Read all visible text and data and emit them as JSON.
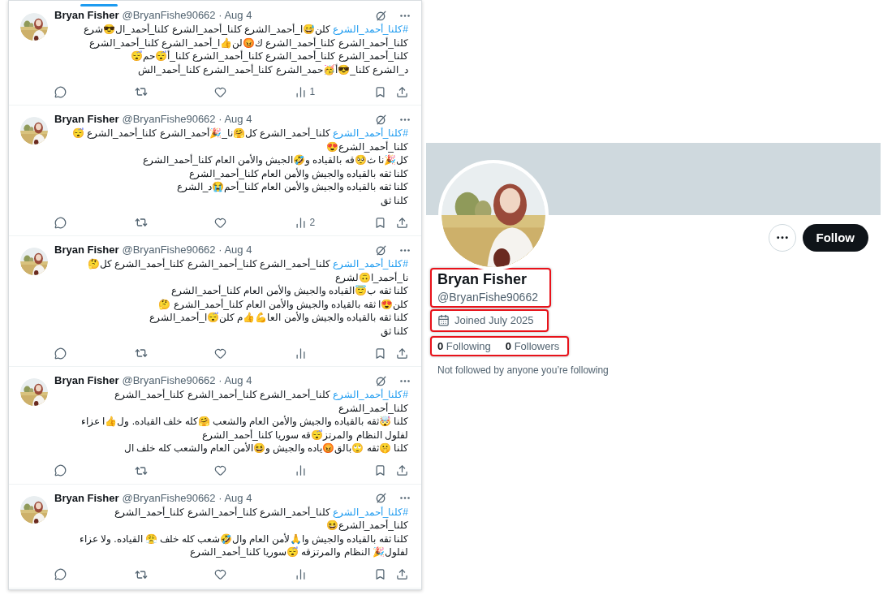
{
  "timeline": {
    "tweets": [
      {
        "author": "Bryan Fisher",
        "meta": "@BryanFishe90662 · Aug 4",
        "hashtag": "#كلنا_أحمد_الشرع",
        "first_line": " كلن😅ا_أحمد_الشرع كلنا_أحمد_الشرع كلنا_أحمد_ال😎شرع",
        "lines": [
          "كلنا_أحمد_الشرع كلنا_أحمد_الشرع ك😡لن👍ا_أحمد_الشرع كلنا_أحمد_الشرع",
          "كلنا_أحمد_الشرع كلنا_أحمد_الشرع كلنا_أحمد_الشرع كلنا_أ😴حم😴",
          "د_الشرع كلنا_😎أ🥳حمد_الشرع كلنا_أحمد_الشرع كلنا_أحمد_الش"
        ],
        "views": "1"
      },
      {
        "author": "Bryan Fisher",
        "meta": "@BryanFishe90662 · Aug 4",
        "hashtag": "#كلنا_أحمد_الشرع",
        "first_line": " كلنا_أحمد_الشرع كل🤗نا_🎉أحمد_الشرع كلنا_أحمد_الشرع 😴",
        "lines": [
          "كلنا_أحمد_الشرع😍",
          "كل🎉نا ث🥺قه بالقياده و🤣الجيش والأمن العام كلنا_أحمد_الشرع",
          "كلنا ثقه بالقياده والجيش والأمن العام كلنا_أحمد_الشرع",
          "كلنا ثقه بالقياده والجيش والأمن العام كلنا_أحم😭د_الشرع",
          "كلنا ثق"
        ],
        "views": "2"
      },
      {
        "author": "Bryan Fisher",
        "meta": "@BryanFishe90662 · Aug 4",
        "hashtag": "#كلنا_أحمد_الشرع",
        "first_line": " كلنا_أحمد_الشرع كلنا_أحمد_الشرع كلنا_أحمد_الشرع كل🤔",
        "lines": [
          "نا_أحمد_ا🙃لشرع",
          "كلنا ثقه ب😇القياده والجيش والأمن العام كلنا_أحمد_الشرع",
          "كلن😍ا ثقه بالقياده والجيش والأمن العام كلنا_أحمد_الشرع 🤔",
          "كلنا ثقه بالقياده والجيش والأمن العا💪👍م كلن😴ا_أحمد_الشرع",
          "كلنا ثق"
        ]
      },
      {
        "author": "Bryan Fisher",
        "meta": "@BryanFishe90662 · Aug 4",
        "hashtag": "#كلنا_أحمد_الشرع",
        "first_line": " كلنا_أحمد_الشرع كلنا_أحمد_الشرع كلنا_أحمد_الشرع",
        "lines": [
          "كلنا_أحمد_الشرع",
          "كلنا 🤯ثقه بالقياده والجيش والأمن العام والشعب 🤗كله خلف القياده. ول👍ا عزاء",
          "لفلول النظام والمرتز😴قه سوريا كلنا_أحمد_الشرع",
          "كلنا 🤫ثقه 🙄بالق😡ياده والجيش و😆الأمن العام والشعب كله خلف ال"
        ]
      },
      {
        "author": "Bryan Fisher",
        "meta": "@BryanFishe90662 · Aug 4",
        "hashtag": "#كلنا_أحمد_الشرع",
        "first_line": " كلنا_أحمد_الشرع كلنا_أحمد_الشرع كلنا_أحمد_الشرع",
        "lines": [
          "كلنا_أحمد_الشرع😆",
          "كلنا ثقه بالقياده والجيش وا🙏لأمن العام وال🤣شعب كله خلف 😤 القياده. ولا عزاء",
          "لفلول🎉 النظام والمرتزقه 😴سوريا كلنا_أحمد_الشرع"
        ]
      }
    ]
  },
  "profile": {
    "follow_button": "Follow",
    "identity": {
      "name": "Bryan Fisher",
      "handle": "@BryanFishe90662",
      "highlighted": true
    },
    "joined": {
      "text": "Joined July 2025",
      "highlighted": true
    },
    "stats": {
      "following_count": "0",
      "following_label": "Following",
      "followers_count": "0",
      "followers_label": "Followers",
      "highlighted": true
    },
    "note": "Not followed by anyone you’re following"
  }
}
